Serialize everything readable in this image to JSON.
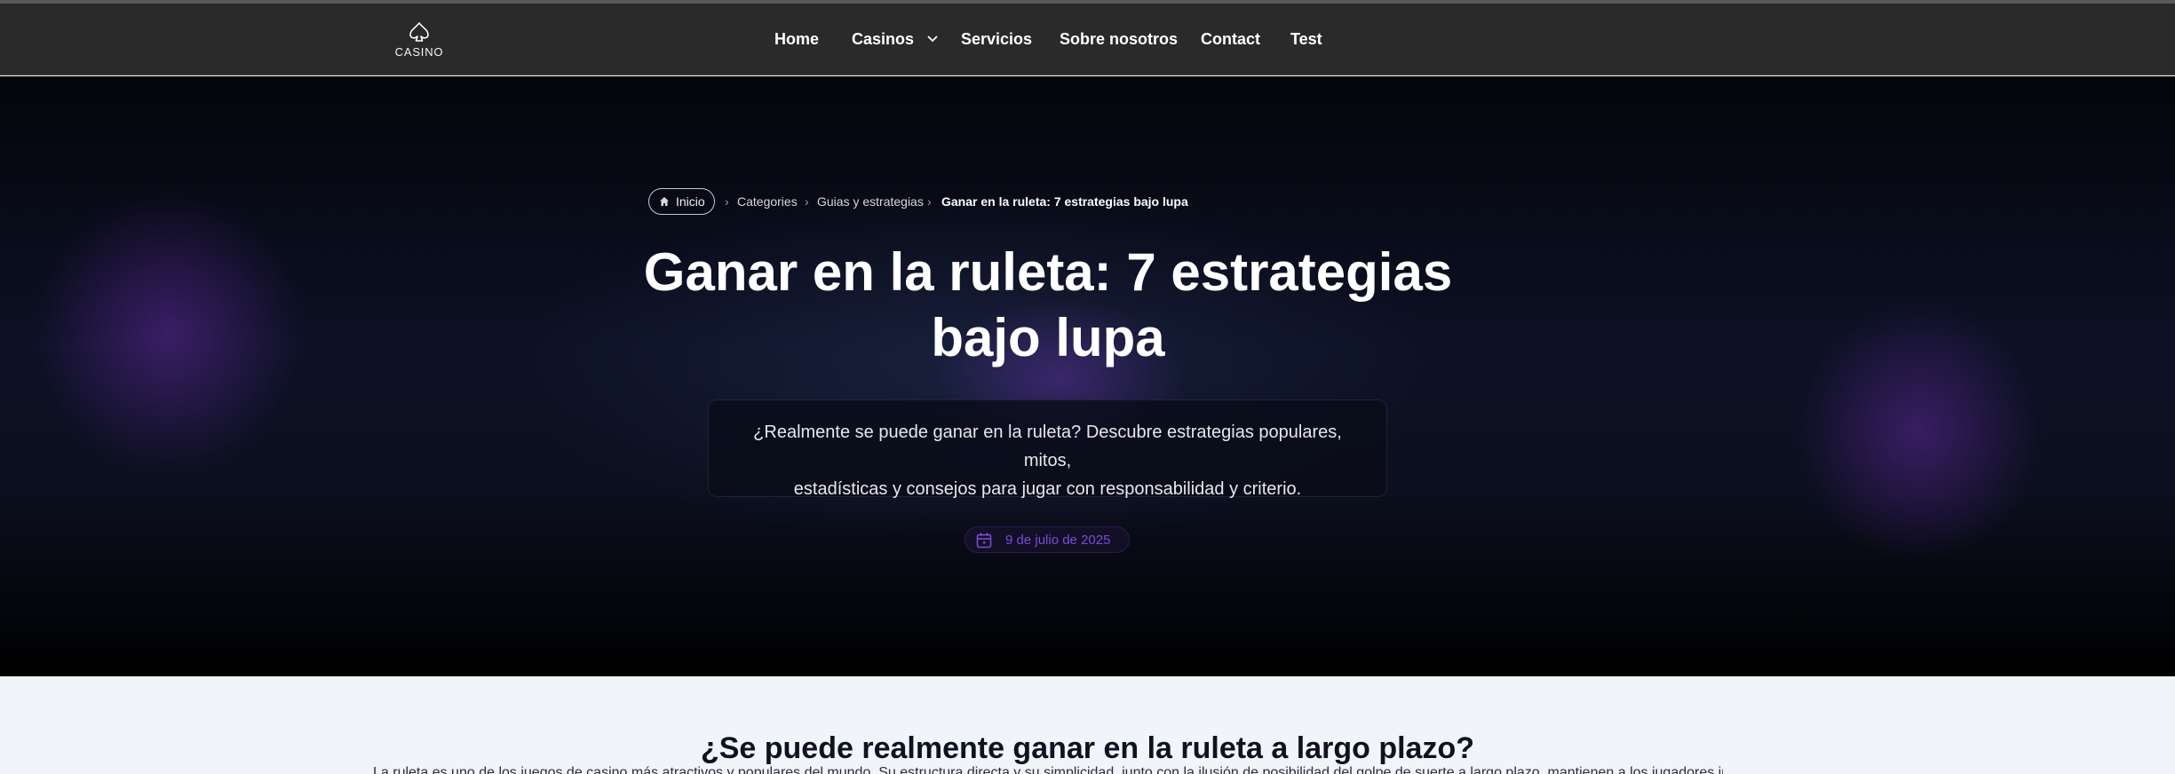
{
  "logo": {
    "icon": "spade-icon",
    "text": "CASINO"
  },
  "nav": {
    "items": [
      {
        "label": "Home"
      },
      {
        "label": "Casinos",
        "icon": "chevron-down-icon"
      },
      {
        "label": "Servicios"
      },
      {
        "label": "Sobre nosotros"
      },
      {
        "label": "Contact"
      },
      {
        "label": "Test"
      }
    ]
  },
  "breadcrumb": {
    "home_icon": "home-icon",
    "home_label": "Inicio",
    "separator": "›",
    "items": [
      "Categories",
      "Guias y estrategias"
    ],
    "current": "Ganar en la ruleta: 7 estrategias bajo lupa"
  },
  "article": {
    "title_line1": "Ganar en la ruleta: 7 estrategias",
    "title_line2": "bajo lupa",
    "excerpt_line1": "¿Realmente se puede ganar en la ruleta? Descubre estrategias populares, mitos,",
    "excerpt_line2": "estadísticas y consejos para jugar con responsabilidad y criterio.",
    "date_icon": "calendar-icon",
    "date": "9 de julio de 2025"
  },
  "content": {
    "heading": "¿Se puede realmente ganar en la ruleta a largo plazo?",
    "first_line": "La ruleta es uno de los juegos de casino más atractivos y populares del mundo. Su estructura directa y su simplicidad, junto con la ilusión de posibilidad del golpe de suerte a largo plazo, mantienen a los jugadores interesados."
  },
  "colors": {
    "navbar": "#2a2a2a",
    "hero_dark": "#04050b",
    "accent_purple": "#7b4cd6",
    "content_bg": "#f1f4f8"
  }
}
